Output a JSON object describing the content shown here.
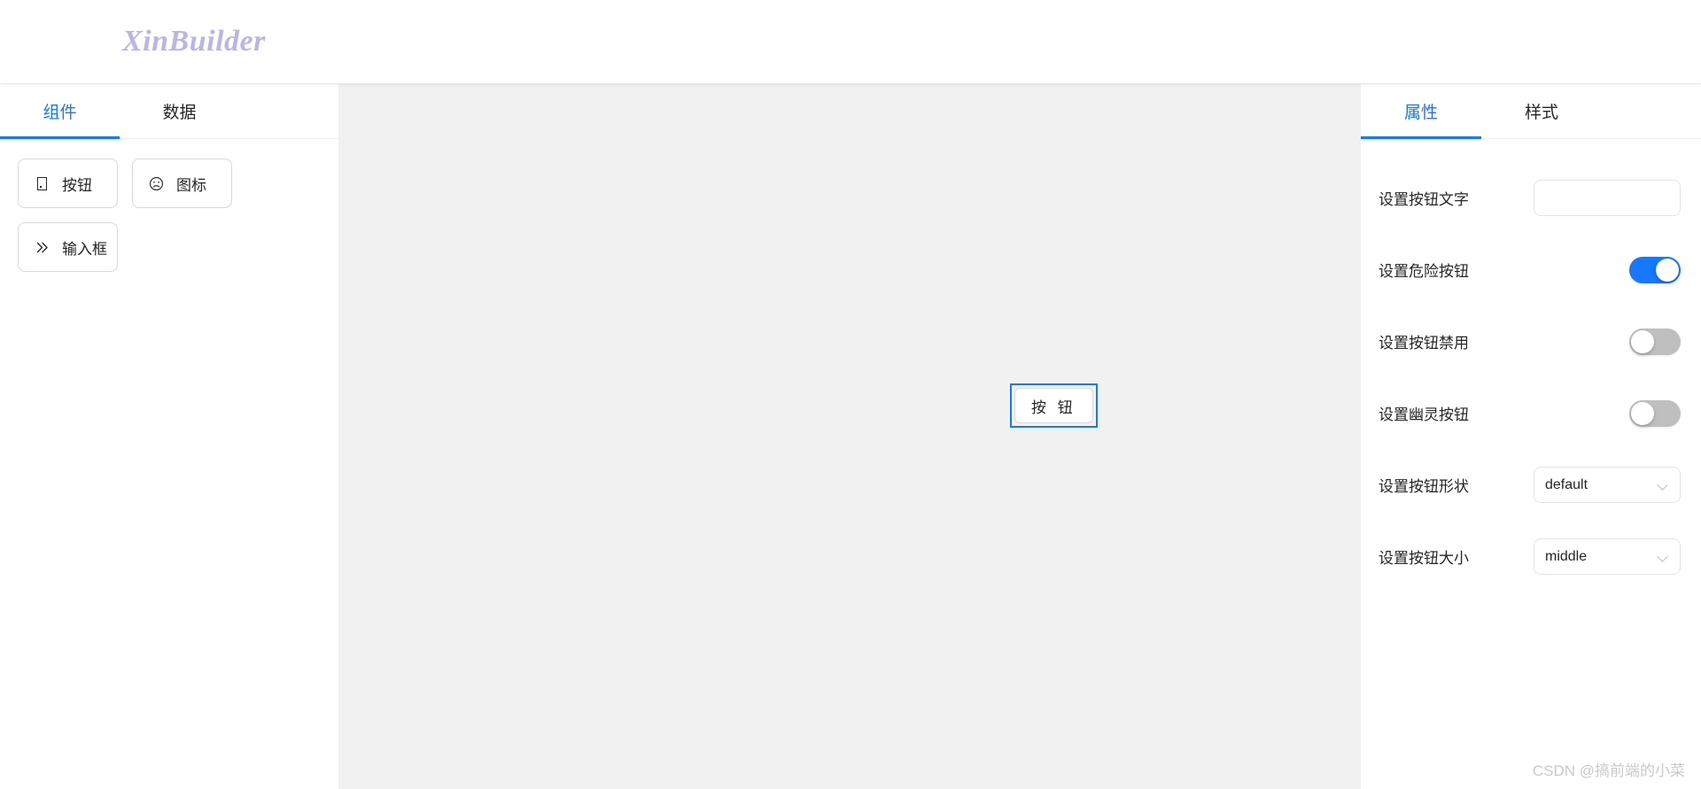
{
  "header": {
    "logo": "XinBuilder"
  },
  "left_panel": {
    "tabs": [
      {
        "label": "组件",
        "active": true
      },
      {
        "label": "数据",
        "active": false
      }
    ],
    "palette": [
      {
        "label": "按钮",
        "icon": "square-outline-icon"
      },
      {
        "label": "图标",
        "icon": "frown-face-icon"
      },
      {
        "label": "输入框",
        "icon": "double-chevron-right-icon"
      }
    ]
  },
  "canvas": {
    "selected_component": {
      "label": "按 钮",
      "selected": true
    }
  },
  "right_panel": {
    "tabs": [
      {
        "label": "属性",
        "active": true
      },
      {
        "label": "样式",
        "active": false
      }
    ],
    "properties": [
      {
        "label": "设置按钮文字",
        "type": "text",
        "value": "",
        "placeholder": ""
      },
      {
        "label": "设置危险按钮",
        "type": "switch",
        "value": "on"
      },
      {
        "label": "设置按钮禁用",
        "type": "switch",
        "value": "off"
      },
      {
        "label": "设置幽灵按钮",
        "type": "switch",
        "value": "off"
      },
      {
        "label": "设置按钮形状",
        "type": "select",
        "value": "default"
      },
      {
        "label": "设置按钮大小",
        "type": "select",
        "value": "middle"
      }
    ]
  },
  "watermark": {
    "text": "CSDN @搞前端的小菜"
  },
  "colors": {
    "accent": "#1677ff",
    "logo": "#b8b6e8",
    "canvas_bg": "#f1f1f1",
    "switch_off": "#bfbfbf",
    "border": "#d9d9d9"
  }
}
